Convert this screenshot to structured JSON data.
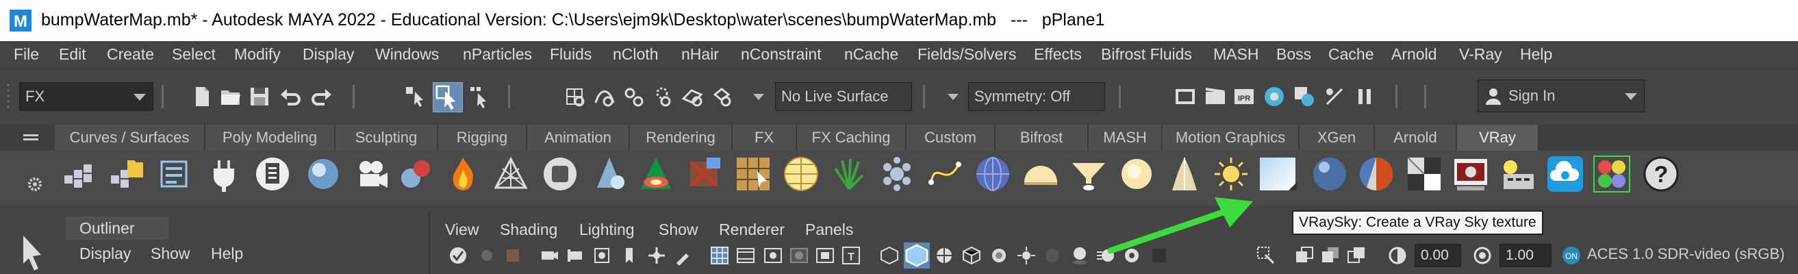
{
  "title_bar": {
    "app_logo_letter": "M",
    "text": "bumpWaterMap.mb* - Autodesk MAYA 2022 - Educational Version: C:\\Users\\ejm9k\\Desktop\\water\\scenes\\bumpWaterMap.mb   ---   pPlane1"
  },
  "menu_bar": [
    "File",
    "Edit",
    "Create",
    "Select",
    "Modify",
    "Display",
    "Windows",
    "nParticles",
    "Fluids",
    "nCloth",
    "nHair",
    "nConstraint",
    "nCache",
    "Fields/Solvers",
    "Effects",
    "Bifrost Fluids",
    "MASH",
    "Boss",
    "Cache",
    "Arnold",
    "V-Ray",
    "Help"
  ],
  "status_line": {
    "menu_set": "FX",
    "live_surface": "No Live Surface",
    "symmetry": "Symmetry: Off",
    "sign_in": "Sign In"
  },
  "shelf_tabs": [
    "Curves / Surfaces",
    "Poly Modeling",
    "Sculpting",
    "Rigging",
    "Animation",
    "Rendering",
    "FX",
    "FX Caching",
    "Custom",
    "Bifrost",
    "MASH",
    "Motion Graphics",
    "XGen",
    "Arnold",
    "VRay"
  ],
  "active_shelf_tab": "VRay",
  "shelf_icons": [
    "vray-lights-icon",
    "vray-folder-icon",
    "vray-settings-icon",
    "vray-plug-icon",
    "vray-clipboard-icon",
    "vray-sphere-icon",
    "vray-camera-icon",
    "vray-spheres-icon",
    "vray-fire-icon",
    "vray-mesh-icon",
    "vray-cube-icon",
    "vray-cone-icon",
    "vray-volume-icon",
    "vray-wall-icon",
    "vray-proxy-icon",
    "vray-dome-icon",
    "vray-grass-icon",
    "vray-fur-icon",
    "vray-curve-icon",
    "vray-globe-icon",
    "vray-dome-light-icon",
    "vray-spot-light-icon",
    "vray-sphere-light-icon",
    "vray-ies-light-icon",
    "vray-sun-icon",
    "vray-sky-icon",
    "vray-blue-sphere-icon",
    "vray-material-icon",
    "vray-checker-icon",
    "vray-vfb-icon",
    "vray-options-icon",
    "vray-cloud-icon",
    "vray-swatches-icon",
    "vray-help-icon"
  ],
  "outliner": {
    "title": "Outliner",
    "menus": [
      "Display",
      "Show",
      "Help"
    ]
  },
  "viewport": {
    "menus": [
      "View",
      "Shading",
      "Lighting",
      "Show",
      "Renderer",
      "Panels"
    ],
    "exposure": "0.00",
    "gamma": "1.00",
    "color_space": "ACES 1.0 SDR-video (sRGB)"
  },
  "tooltip": "VRaySky: Create a VRay Sky texture",
  "colors": {
    "annotation_arrow": "#3ddc3d",
    "active_tab": "#5c5c5c",
    "toolbar_bg": "#444444"
  }
}
